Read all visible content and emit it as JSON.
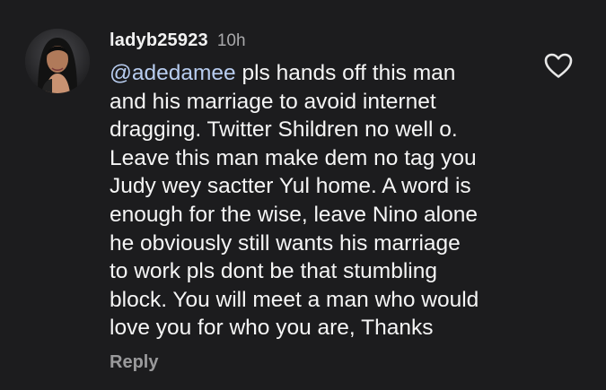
{
  "comment": {
    "username": "ladyb25923",
    "time": "10h",
    "mention": "@adedamee",
    "text": " pls hands off this man\nand his marriage to avoid internet\ndragging. Twitter Shildren no well o.\nLeave this man make dem no tag you\nJudy wey sactter Yul home. A word is\nenough for the wise, leave Nino alone\nhe obviously still wants his marriage\nto work pls dont be that stumbling\nblock. You will meet a man who would\nlove you for who you are, Thanks",
    "reply_label": "Reply",
    "like_icon": "heart-outline-icon"
  },
  "colors": {
    "background": "#1c1c1e",
    "text": "#f5f5f5",
    "mention": "#b8cdf0",
    "muted": "#9a9a9c"
  }
}
